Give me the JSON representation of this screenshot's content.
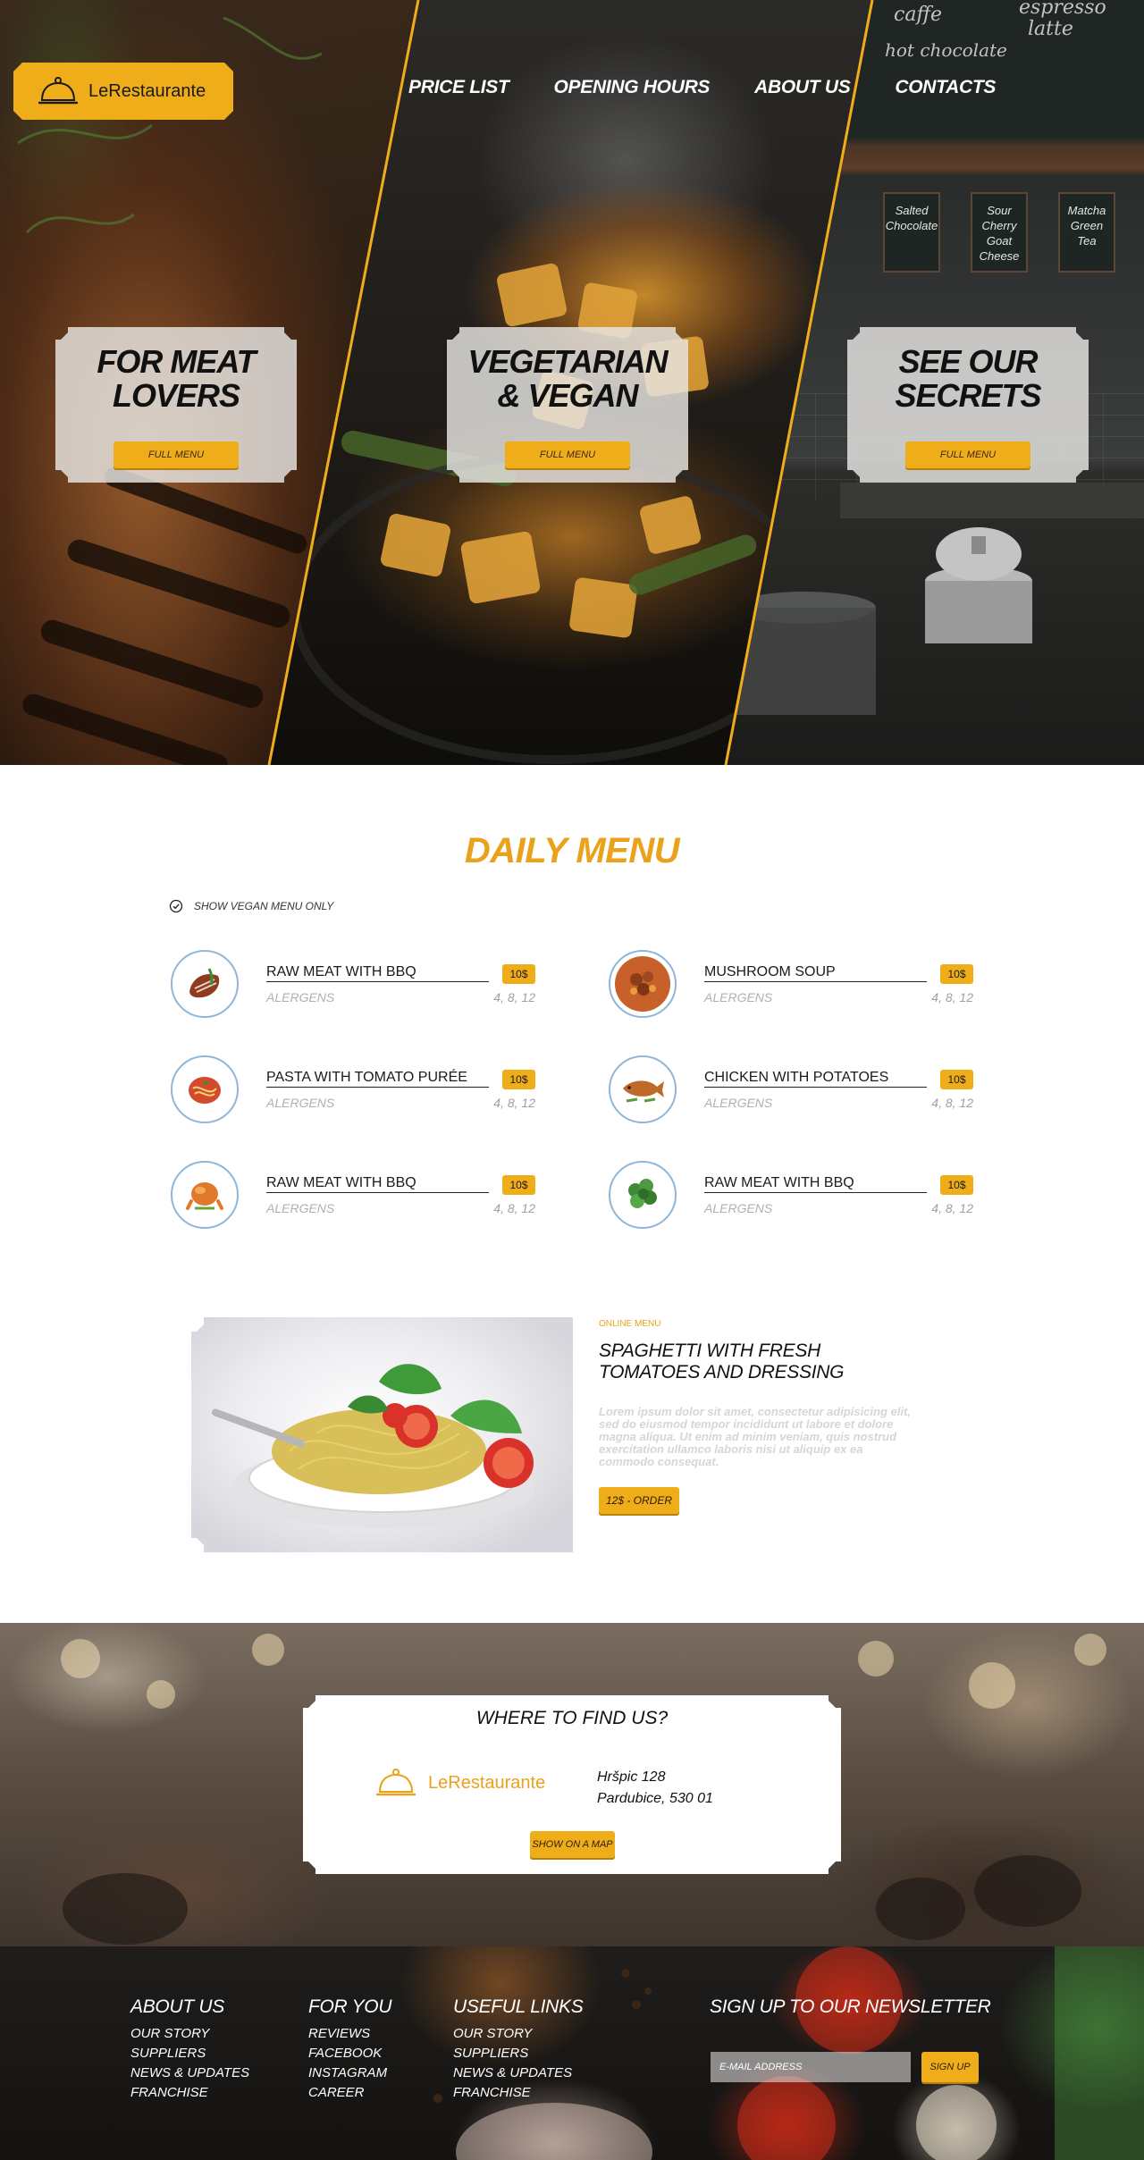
{
  "brand": {
    "name": "LeRestaurante",
    "accent": "#f0ad1a",
    "accent_text": "#eaa21b"
  },
  "nav": {
    "items": [
      "PRICE LIST",
      "OPENING HOURS",
      "ABOUT US",
      "CONTACTS"
    ]
  },
  "hero": {
    "chalkboard_words": [
      "espresso",
      "latte",
      "hot chocolate",
      "caffe"
    ],
    "board_signs": [
      "Salted Chocolate",
      "Sour Cherry Goat Cheese",
      "Matcha Green Tea"
    ],
    "cards": [
      {
        "title_line1": "FOR MEAT",
        "title_line2": "LOVERS",
        "button": "FULL MENU"
      },
      {
        "title_line1": "VEGETARIAN",
        "title_line2": "& VEGAN",
        "button": "FULL MENU"
      },
      {
        "title_line1": "SEE OUR",
        "title_line2": "SECRETS",
        "button": "FULL MENU"
      }
    ]
  },
  "daily_menu": {
    "title": "DAILY MENU",
    "vegan_toggle": "SHOW VEGAN MENU ONLY",
    "items": [
      {
        "name": "RAW MEAT WITH BBQ",
        "price": "10$",
        "allergens_label": "ALERGENS",
        "allergens": "4, 8, 12",
        "icon": "meat-icon"
      },
      {
        "name": "MUSHROOM SOUP",
        "price": "10$",
        "allergens_label": "ALERGENS",
        "allergens": "4, 8, 12",
        "icon": "soup-icon"
      },
      {
        "name": "PASTA WITH TOMATO PURÉE",
        "price": "10$",
        "allergens_label": "ALERGENS",
        "allergens": "4, 8, 12",
        "icon": "pasta-icon"
      },
      {
        "name": "CHICKEN WITH POTATOES",
        "price": "10$",
        "allergens_label": "ALERGENS",
        "allergens": "4, 8, 12",
        "icon": "fish-icon"
      },
      {
        "name": "RAW MEAT WITH BBQ",
        "price": "10$",
        "allergens_label": "ALERGENS",
        "allergens": "4, 8, 12",
        "icon": "roast-chicken-icon"
      },
      {
        "name": "RAW MEAT WITH BBQ",
        "price": "10$",
        "allergens_label": "ALERGENS",
        "allergens": "4, 8, 12",
        "icon": "broccoli-icon"
      }
    ]
  },
  "feature": {
    "label": "ONLINE MENU",
    "title": "SPAGHETTI WITH FRESH TOMATOES AND DRESSING",
    "text": "Lorem ipsum dolor sit amet, consectetur adipisicing elit, sed do eiusmod tempor incididunt ut labore et dolore magna aliqua. Ut enim ad minim veniam, quis nostrud exercitation ullamco laboris nisi ut aliquip ex ea commodo consequat.",
    "button": "12$ - ORDER"
  },
  "where": {
    "title": "WHERE TO FIND US?",
    "address_line1": "Hršpic 128",
    "address_line2": "Pardubice, 530 01",
    "button": "SHOW ON A MAP"
  },
  "footer": {
    "columns": [
      {
        "title": "ABOUT US",
        "links": [
          "OUR STORY",
          "SUPPLIERS",
          "NEWS & UPDATES",
          "FRANCHISE"
        ]
      },
      {
        "title": "FOR YOU",
        "links": [
          "REVIEWS",
          "FACEBOOK",
          "INSTAGRAM",
          "CAREER"
        ]
      },
      {
        "title": "USEFUL LINKS",
        "links": [
          "OUR STORY",
          "SUPPLIERS",
          "NEWS & UPDATES",
          "FRANCHISE"
        ]
      }
    ],
    "newsletter": {
      "title": "SIGN UP TO OUR NEWSLETTER",
      "placeholder": "E-MAIL ADDRESS",
      "button": "SIGN UP"
    }
  }
}
